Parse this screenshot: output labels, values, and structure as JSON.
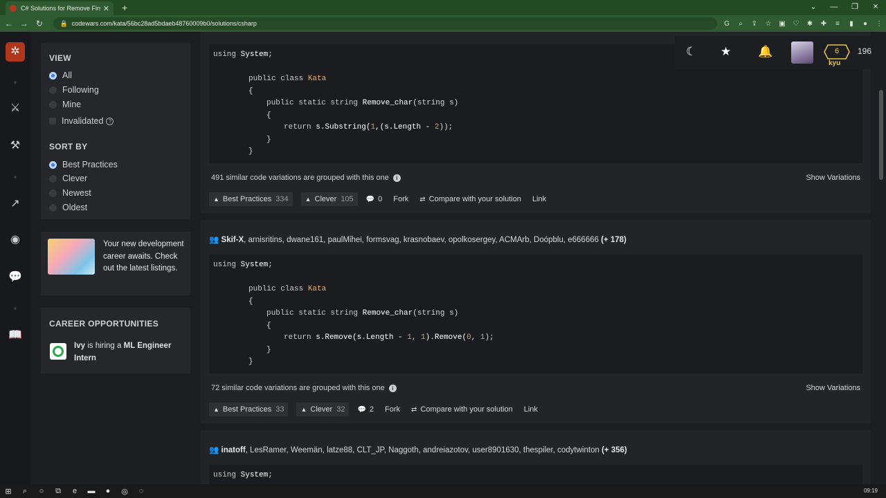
{
  "browser": {
    "tab_title": "C# Solutions for Remove First an",
    "tab_close": "✕",
    "new_tab": "+",
    "url": "codewars.com/kata/56bc28ad5bdaeb48760009b0/solutions/csharp"
  },
  "filters": {
    "view_title": "VIEW",
    "view_options": [
      "All",
      "Following",
      "Mine"
    ],
    "invalidated_label": "Invalidated",
    "sort_title": "SORT BY",
    "sort_options": [
      "Best Practices",
      "Clever",
      "Newest",
      "Oldest"
    ]
  },
  "ad": {
    "text": "Your new development career awaits. Check out the latest listings."
  },
  "career": {
    "title": "CAREER OPPORTUNITIES",
    "company": "Ivy",
    "is_hiring": "is hiring a",
    "role": "ML Engineer Intern"
  },
  "header": {
    "rank_number": "6",
    "rank_label": "kyu",
    "honor": "196"
  },
  "solutions": [
    {
      "code_lines": {
        "l1": [
          "using",
          "System",
          ";"
        ],
        "l2": [
          "public class",
          "Kata"
        ],
        "l3": "{",
        "l4": [
          "public static string",
          "Remove_char",
          "(string s)"
        ],
        "l5": "{",
        "l6": [
          "return",
          "s.Substring(",
          "1",
          ",(s.Length - ",
          "2",
          "));"
        ],
        "l7": "}",
        "l8": "}"
      },
      "variations_text": "491 similar code variations are grouped with this one",
      "show_variations": "Show Variations",
      "best_practices_label": "Best Practices",
      "best_practices_count": "334",
      "clever_label": "Clever",
      "clever_count": "105",
      "comments": "0",
      "fork": "Fork",
      "compare": "Compare with your solution",
      "link": "Link"
    },
    {
      "authors_lead": "Skif-X",
      "authors_rest": ", arnisritins, dwane161, paulMihei, formsvag, krasnobaev, opolkosergey, ACMArb, Doópblu, e666666",
      "authors_more": "(+ 178)",
      "code_lines": {
        "l1": [
          "using",
          "System",
          ";"
        ],
        "l2": [
          "public class",
          "Kata"
        ],
        "l3": "{",
        "l4": [
          "public static string",
          "Remove_char",
          "(string s)"
        ],
        "l5": "{",
        "l6": [
          "return",
          "s.Remove(s.Length - ",
          "1",
          ", ",
          "1",
          ").Remove(",
          "0",
          ", ",
          "1",
          ");"
        ],
        "l7": "}",
        "l8": "}"
      },
      "variations_text": "72 similar code variations are grouped with this one",
      "show_variations": "Show Variations",
      "best_practices_label": "Best Practices",
      "best_practices_count": "33",
      "clever_label": "Clever",
      "clever_count": "32",
      "comments": "2",
      "fork": "Fork",
      "compare": "Compare with your solution",
      "link": "Link"
    },
    {
      "authors_lead": "inatoff",
      "authors_rest": ", LesRamer, Weemän, latze88, CLT_JP, Naggoth, andreiazotov, user8901630, thespiler, codytwinton",
      "authors_more": "(+ 356)",
      "code_first": [
        "using",
        "System",
        ";"
      ]
    }
  ],
  "taskbar": {
    "time": "09:19"
  }
}
